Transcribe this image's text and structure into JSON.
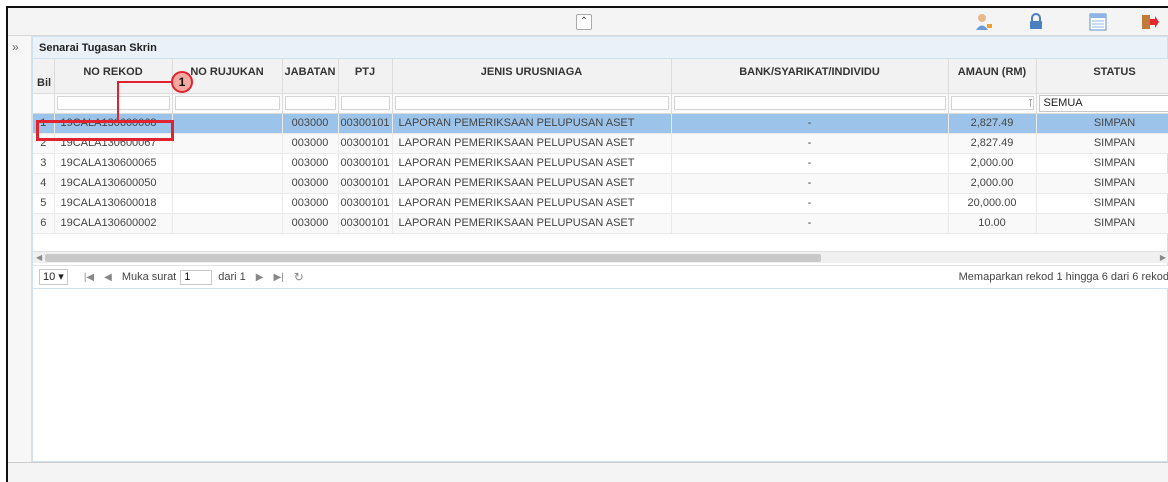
{
  "toolbar": {
    "collapse_icon": "double-chevron-up-icon",
    "icons": [
      "user-profile-icon",
      "lock-icon",
      "list-view-icon",
      "logout-icon"
    ]
  },
  "panel": {
    "title": "Senarai Tugasan Skrin"
  },
  "grid": {
    "columns": [
      "Bil",
      "NO REKOD",
      "NO RUJUKAN",
      "JABATAN",
      "PTJ",
      "JENIS URUSNIAGA",
      "BANK/SYARIKAT/INDIVIDU",
      "AMAUN (RM)",
      "STATUS"
    ],
    "status_filter": "SEMUA",
    "rows": [
      {
        "bil": "1",
        "no_rekod": "19CALA130600068",
        "no_rujukan": "",
        "jabatan": "003000",
        "ptj": "00300101",
        "jenis": "LAPORAN PEMERIKSAAN PELUPUSAN ASET",
        "bank": "-",
        "amaun": "2,827.49",
        "status": "SIMPAN"
      },
      {
        "bil": "2",
        "no_rekod": "19CALA130600067",
        "no_rujukan": "",
        "jabatan": "003000",
        "ptj": "00300101",
        "jenis": "LAPORAN PEMERIKSAAN PELUPUSAN ASET",
        "bank": "-",
        "amaun": "2,827.49",
        "status": "SIMPAN"
      },
      {
        "bil": "3",
        "no_rekod": "19CALA130600065",
        "no_rujukan": "",
        "jabatan": "003000",
        "ptj": "00300101",
        "jenis": "LAPORAN PEMERIKSAAN PELUPUSAN ASET",
        "bank": "-",
        "amaun": "2,000.00",
        "status": "SIMPAN"
      },
      {
        "bil": "4",
        "no_rekod": "19CALA130600050",
        "no_rujukan": "",
        "jabatan": "003000",
        "ptj": "00300101",
        "jenis": "LAPORAN PEMERIKSAAN PELUPUSAN ASET",
        "bank": "-",
        "amaun": "2,000.00",
        "status": "SIMPAN"
      },
      {
        "bil": "5",
        "no_rekod": "19CALA130600018",
        "no_rujukan": "",
        "jabatan": "003000",
        "ptj": "00300101",
        "jenis": "LAPORAN PEMERIKSAAN PELUPUSAN ASET",
        "bank": "-",
        "amaun": "20,000.00",
        "status": "SIMPAN"
      },
      {
        "bil": "6",
        "no_rekod": "19CALA130600002",
        "no_rujukan": "",
        "jabatan": "003000",
        "ptj": "00300101",
        "jenis": "LAPORAN PEMERIKSAAN PELUPUSAN ASET",
        "bank": "-",
        "amaun": "10.00",
        "status": "SIMPAN"
      }
    ]
  },
  "pager": {
    "page_size": "10",
    "page_label": "Muka surat",
    "page_value": "1",
    "of_label": "dari 1",
    "info": "Memaparkan rekod 1 hingga 6 dari 6 rekod"
  },
  "callout": {
    "number": "1"
  }
}
